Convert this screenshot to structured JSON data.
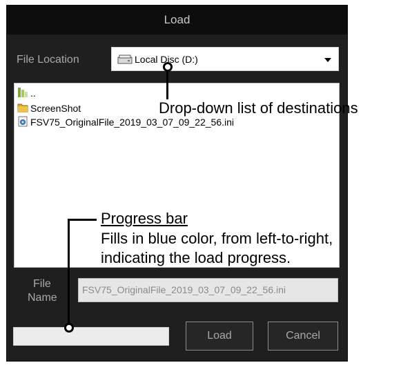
{
  "dialog": {
    "title": "Load",
    "file_location_label": "File Location",
    "file_location_value": "Local Disc (D:)",
    "file_list": [
      {
        "name": "..",
        "icon": "parent-folder-icon"
      },
      {
        "name": "ScreenShot",
        "icon": "folder-icon"
      },
      {
        "name": "FSV75_OriginalFile_2019_03_07_09_22_56.ini",
        "icon": "ini-file-icon"
      }
    ],
    "file_name_label_line1": "File",
    "file_name_label_line2": "Name",
    "file_name_value": "FSV75_OriginalFile_2019_03_07_09_22_56.ini",
    "progress_fraction": 0,
    "load_label": "Load",
    "cancel_label": "Cancel"
  },
  "annotations": {
    "dropdown": "Drop-down list of destinations",
    "progress_title": "Progress bar",
    "progress_line1": "Fills in blue color, from left-to-right,",
    "progress_line2": "indicating the load progress."
  },
  "colors": {
    "dialog_bg": "#1f1f1f",
    "titlebar_bg": "#0d0d0d",
    "progress_fill": "#1e6fd9"
  }
}
